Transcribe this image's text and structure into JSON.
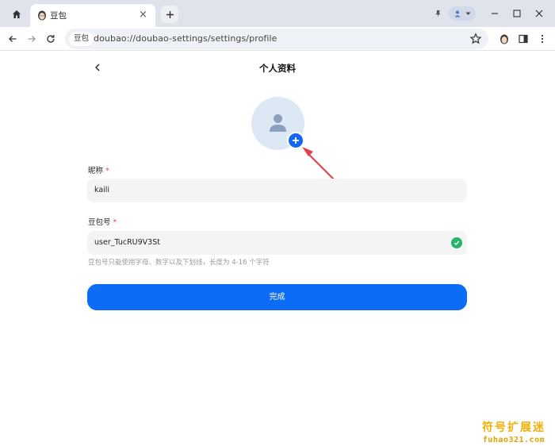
{
  "browser": {
    "tab_title": "豆包",
    "site_chip": "豆包",
    "url": "doubao://doubao-settings/settings/profile"
  },
  "icons": {
    "home": "home-icon",
    "new_tab": "plus-icon",
    "back": "arrow-left-icon",
    "forward": "arrow-right-icon",
    "reload": "reload-icon",
    "star": "star-icon",
    "pin": "pin-icon",
    "profile": "profile-icon",
    "minimize": "minimize-icon",
    "maximize": "maximize-icon",
    "close": "close-icon",
    "extension": "avatar-icon",
    "side_panel": "side-panel-icon",
    "menu": "more-vert-icon"
  },
  "page": {
    "title": "个人资料",
    "nickname": {
      "label": "昵称",
      "required": "*",
      "value": "kaili"
    },
    "doubao_id": {
      "label": "豆包号",
      "required": "*",
      "value": "user_TucRU9V3St",
      "hint": "豆包号只能使用字母、数字以及下划线，长度为 4-16 个字符"
    },
    "submit_label": "完成"
  },
  "watermark": {
    "text": "符号扩展迷",
    "url": "fuhao321.com"
  },
  "colors": {
    "primary": "#0d6cf6",
    "success": "#29b36a",
    "required": "#e5484d",
    "annotation_arrow": "#e0414a",
    "watermark": "#f0b10a"
  }
}
